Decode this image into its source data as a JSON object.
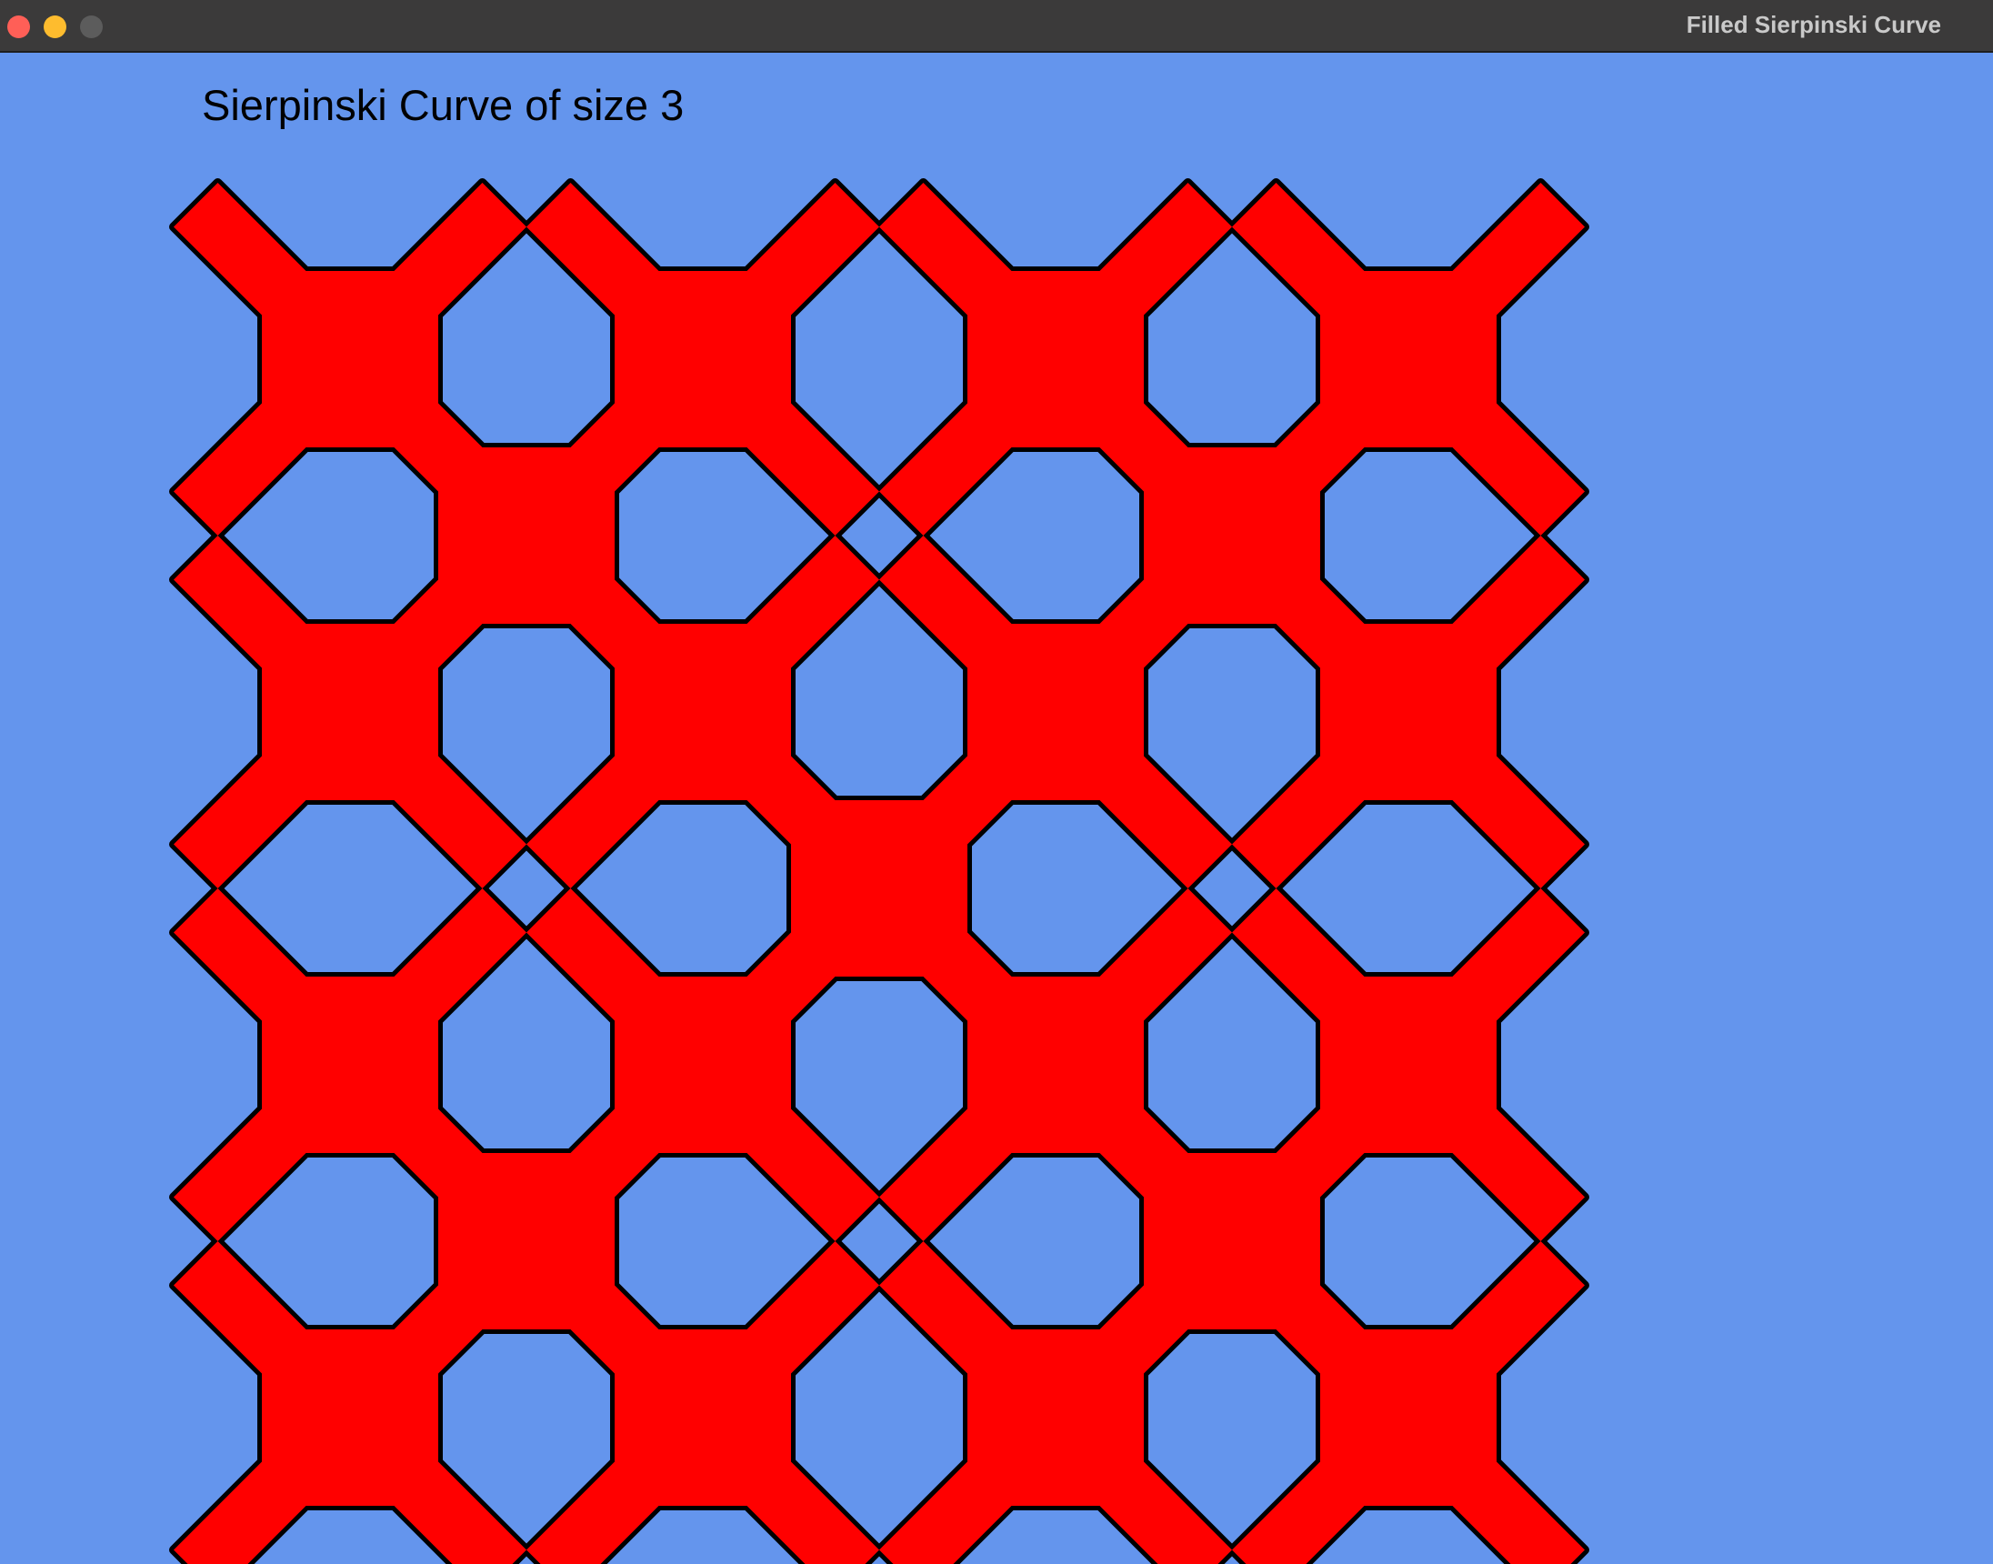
{
  "window": {
    "title": "Filled Sierpinski Curve",
    "controls": {
      "close_icon": "close-icon",
      "minimize_icon": "minimize-icon",
      "zoom_icon": "zoom-icon"
    }
  },
  "canvas": {
    "heading": "Sierpinski Curve of size 3",
    "order": 3,
    "background_color": "#6495ED",
    "fill_color": "#FF0000",
    "stroke_color": "#000000"
  }
}
